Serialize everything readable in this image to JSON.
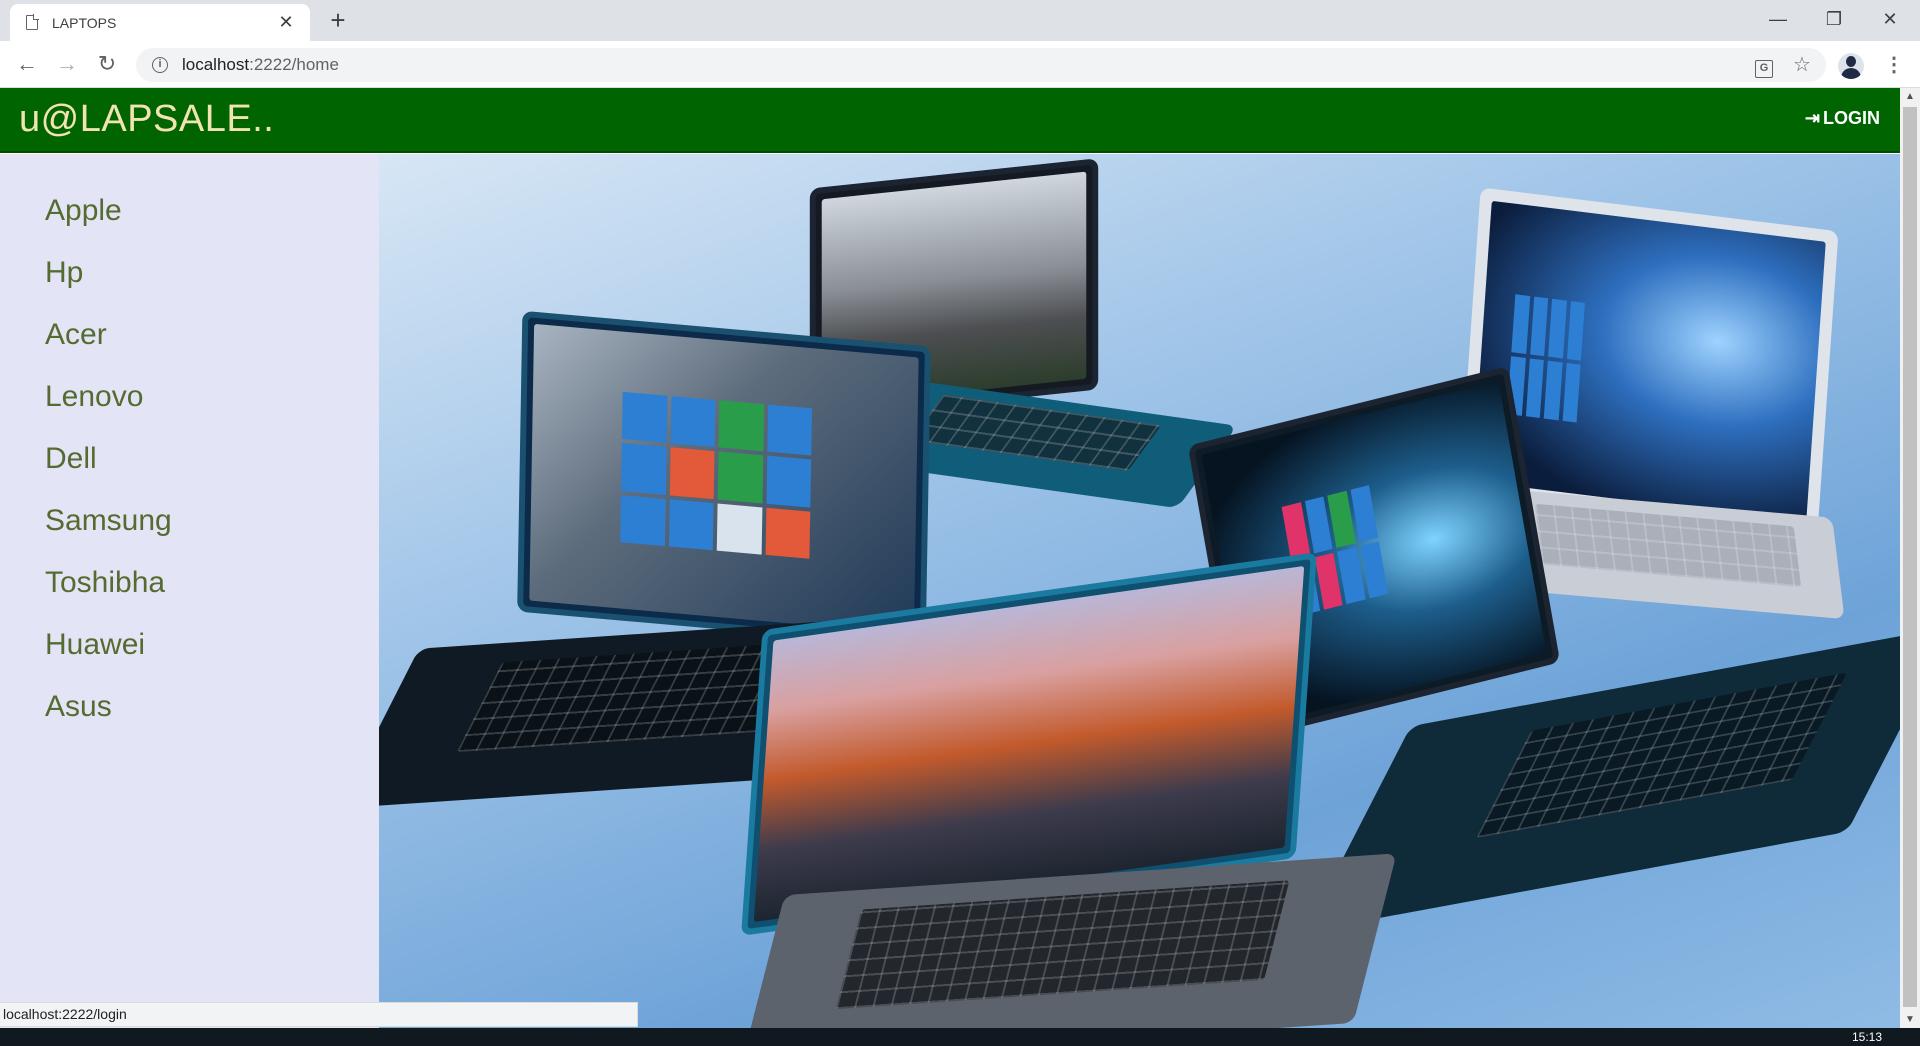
{
  "browser": {
    "tab_title": "LAPTOPS",
    "tab_close": "✕",
    "new_tab": "+",
    "url_host": "localhost",
    "url_rest": ":2222/home",
    "window_controls": {
      "minimize": "—",
      "restore": "❐",
      "close": "✕"
    },
    "nav": {
      "back": "←",
      "forward": "→",
      "reload": "↻"
    },
    "icons": {
      "translate": "translate-icon",
      "star": "☆",
      "menu": "⋮"
    }
  },
  "navbar": {
    "brand": "u@LAPSALE..",
    "login_label": "LOGIN",
    "login_icon": "⇥",
    "bg_color": "#006400",
    "brand_color": "#f3e3b2"
  },
  "sidebar": {
    "bg_color": "#e4e4f7",
    "link_color": "#556b2f",
    "items": [
      {
        "label": "Apple"
      },
      {
        "label": "Hp"
      },
      {
        "label": "Acer"
      },
      {
        "label": "Lenovo"
      },
      {
        "label": "Dell"
      },
      {
        "label": "Samsung"
      },
      {
        "label": "Toshibha"
      },
      {
        "label": "Huawei"
      },
      {
        "label": "Asus"
      }
    ]
  },
  "hero": {
    "image": "laptops-collage"
  },
  "status_bar": {
    "url": "localhost:2222/login"
  },
  "taskbar": {
    "time": "15:13"
  }
}
